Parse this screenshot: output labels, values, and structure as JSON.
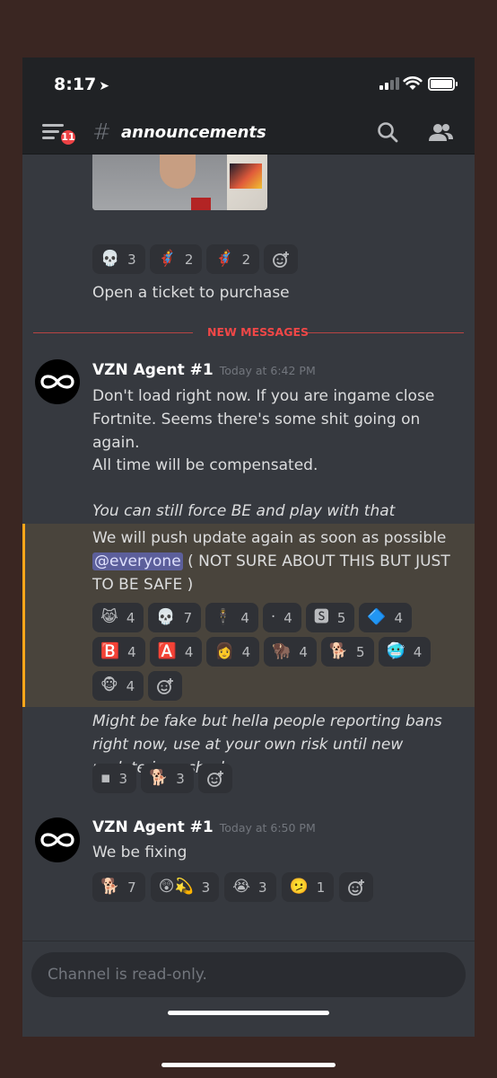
{
  "status_bar": {
    "time": "8:17"
  },
  "header": {
    "badge_count": "11",
    "channel_prefix": "#",
    "channel_name": "announcements"
  },
  "prev_message": {
    "reactions": [
      {
        "emoji": "💀",
        "count": "3"
      },
      {
        "emoji": "🦸",
        "count": "2"
      },
      {
        "emoji": "🦸",
        "count": "2"
      }
    ],
    "text": "Open a ticket to purchase"
  },
  "divider": {
    "label": "NEW MESSAGES"
  },
  "messages": [
    {
      "author": "VZN Agent #1",
      "timestamp": "Today at 6:42 PM",
      "p1": "Don't load right now. If you are ingame close Fortnite. Seems there's some shit going on again.",
      "p2": "All time will be compensated.",
      "p3": "You can still force BE and play with that",
      "p4": "We will push update again as soon as possible",
      "mention": "@everyone",
      "p4_tail": "( NOT SURE ABOUT THIS BUT JUST TO BE SAFE )",
      "reactions": [
        {
          "emoji": "😹",
          "count": "4"
        },
        {
          "emoji": "💀",
          "count": "7"
        },
        {
          "emoji": "🕴",
          "count": "4"
        },
        {
          "emoji": "·",
          "count": "4"
        },
        {
          "emoji": "🆂",
          "count": "5"
        },
        {
          "emoji": "🔷",
          "count": "4"
        },
        {
          "emoji": "🅱️",
          "count": "4"
        },
        {
          "emoji": "🅰️",
          "count": "4"
        },
        {
          "emoji": "👩",
          "count": "4"
        },
        {
          "emoji": "🦬",
          "count": "4"
        },
        {
          "emoji": "🐕",
          "count": "5"
        },
        {
          "emoji": "🥶",
          "count": "4"
        },
        {
          "emoji": "🐵",
          "count": "4"
        }
      ],
      "p5": "Might be fake but hella people reporting bans right now, use at your own risk until new update is pushed",
      "reactions2": [
        {
          "emoji": "▪",
          "count": "3"
        },
        {
          "emoji": "🐕",
          "count": "3"
        }
      ]
    },
    {
      "author": "VZN Agent #1",
      "timestamp": "Today at 6:50 PM",
      "text": "We be fixing",
      "reactions": [
        {
          "emoji": "🐕",
          "count": "7"
        },
        {
          "emoji": "😲💫",
          "count": "3"
        },
        {
          "emoji": "😭",
          "count": "3"
        },
        {
          "emoji": "🫤",
          "count": "1"
        }
      ]
    }
  ],
  "composer": {
    "placeholder": "Channel is read-only."
  }
}
